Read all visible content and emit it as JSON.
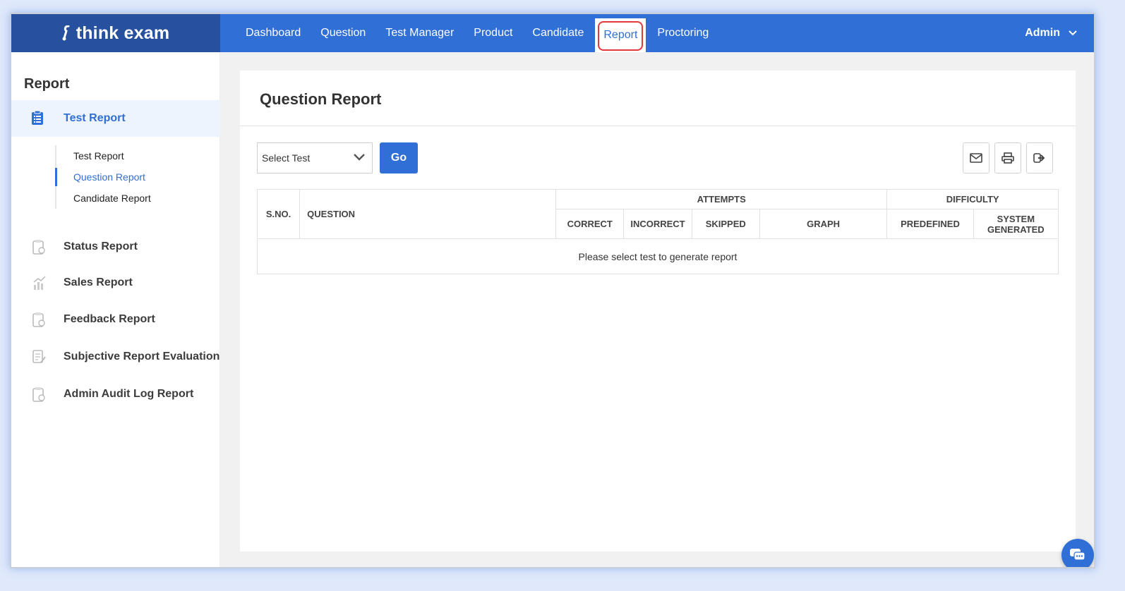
{
  "app": {
    "brand": "think exam"
  },
  "topnav": {
    "items": [
      {
        "label": "Dashboard"
      },
      {
        "label": "Question"
      },
      {
        "label": "Test Manager"
      },
      {
        "label": "Product"
      },
      {
        "label": "Candidate"
      },
      {
        "label": "Report",
        "active": true
      },
      {
        "label": "Proctoring"
      }
    ],
    "user_label": "Admin"
  },
  "sidebar": {
    "title": "Report",
    "main_item": {
      "label": "Test Report",
      "icon": "clipboard-icon"
    },
    "sub_items": [
      {
        "label": "Test Report"
      },
      {
        "label": "Question Report",
        "active": true
      },
      {
        "label": "Candidate Report"
      }
    ],
    "items": [
      {
        "label": "Status Report",
        "icon": "clipboard-icon"
      },
      {
        "label": "Sales Report",
        "icon": "bar-chart-icon"
      },
      {
        "label": "Feedback Report",
        "icon": "clipboard-icon"
      },
      {
        "label": "Subjective Report Evaluation",
        "icon": "edit-document-icon"
      },
      {
        "label": "Admin Audit Log Report",
        "icon": "clipboard-icon"
      }
    ]
  },
  "main": {
    "title": "Question Report",
    "select": {
      "value": "Select Test"
    },
    "go_label": "Go",
    "actions": [
      "email-icon",
      "print-icon",
      "export-icon"
    ],
    "table": {
      "sno": "S.NO.",
      "question": "QUESTION",
      "attempts": "ATTEMPTS",
      "difficulty": "DIFFICULTY",
      "correct": "CORRECT",
      "incorrect": "INCORRECT",
      "skipped": "SKIPPED",
      "graph": "GRAPH",
      "predefined": "PREDEFINED",
      "system_generated": "SYSTEM GENERATED",
      "empty_message": "Please select test to generate report"
    }
  },
  "colors": {
    "primary": "#2f6fd6",
    "logo_bg": "#27509f",
    "highlight": "#e23a3a"
  }
}
